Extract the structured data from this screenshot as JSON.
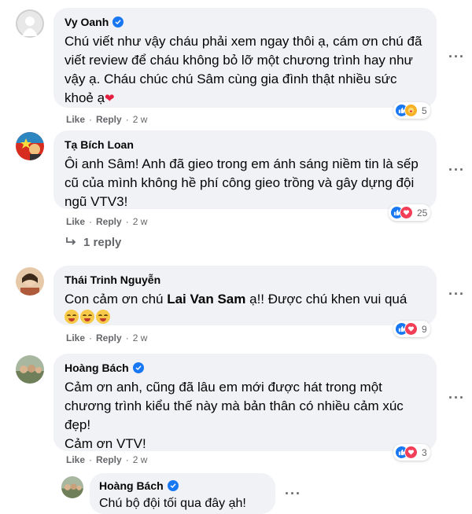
{
  "comments": [
    {
      "author": "Vy Oanh",
      "text": "Chú viết như vậy cháu phải xem ngay thôi ạ, cám ơn chú đã viết review để cháu không bỏ lỡ một chương trình hay như vậy ạ. Cháu chúc chú Sâm cùng gia đình thật nhiều sức khoẻ ạ",
      "like": "Like",
      "reply": "Reply",
      "time": "2 w",
      "reaction_count": "5"
    },
    {
      "author": "Tạ Bích Loan",
      "text": "Ôi anh Sâm! Anh đã gieo trong em ánh sáng niềm tin là sếp cũ của mình không hề phí công gieo trồng và gây dựng đội ngũ VTV3!",
      "like": "Like",
      "reply": "Reply",
      "time": "2 w",
      "reaction_count": "25"
    },
    {
      "author": "Thái Trinh Nguyễn",
      "text_pre": "Con cảm ơn chú ",
      "text_bold": "Lai Van Sam",
      "text_post": " ạ!! Được chú khen vui quá",
      "like": "Like",
      "reply": "Reply",
      "time": "2 w",
      "reaction_count": "9"
    },
    {
      "author": "Hoàng Bách",
      "text": "Cảm ơn anh, cũng đã lâu em mới được hát trong một chương trình kiểu thế này mà bản thân có nhiều cảm xúc đẹp!",
      "text2": "Cảm ơn VTV!",
      "like": "Like",
      "reply": "Reply",
      "time": "2 w",
      "reaction_count": "3"
    }
  ],
  "replies_link": "1 reply",
  "nested_reply": {
    "author": "Hoàng Bách",
    "text": "Chú bộ đội tối qua đây ạh!"
  },
  "more_label": "···",
  "colors": {
    "accent": "#1877f2",
    "bubble": "#f0f2f5",
    "meta": "#65676b",
    "heart": "#e41e3f"
  }
}
